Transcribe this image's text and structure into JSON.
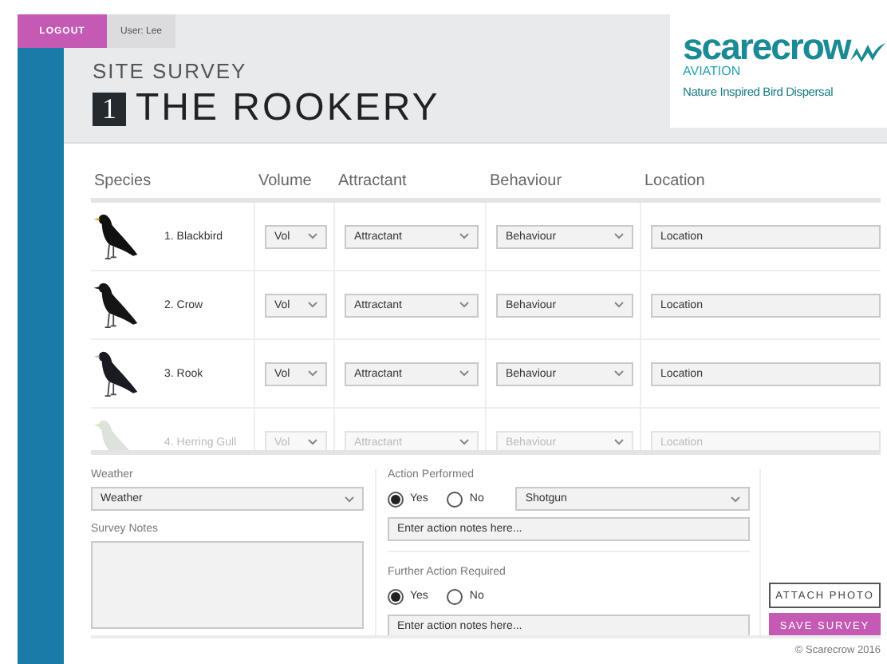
{
  "top_bar": {
    "logout": "LOGOUT",
    "user": "User: Lee"
  },
  "header": {
    "subtitle": "SITE SURVEY",
    "number": "1",
    "title": "THE ROOKERY"
  },
  "logo": {
    "name": "scarecrow",
    "division": "AVIATION",
    "tagline": "Nature Inspired Bird Dispersal"
  },
  "table": {
    "columns": [
      "Species",
      "Volume",
      "Attractant",
      "Behaviour",
      "Location"
    ],
    "rows": [
      {
        "kind": "blackbird",
        "species": "1. Blackbird",
        "volume": "Vol",
        "attractant": "Attractant",
        "behaviour": "Behaviour",
        "location": {
          "placeholder": "Location"
        },
        "dimmed": false
      },
      {
        "kind": "crow",
        "species": "2. Crow",
        "volume": "Vol",
        "attractant": "Attractant",
        "behaviour": "Behaviour",
        "location": {
          "placeholder": "Location"
        },
        "dimmed": false
      },
      {
        "kind": "rook",
        "species": "3. Rook",
        "volume": "Vol",
        "attractant": "Attractant",
        "behaviour": "Behaviour",
        "location": {
          "placeholder": "Location"
        },
        "dimmed": false
      },
      {
        "kind": "gull",
        "species": "4. Herring Gull",
        "volume": "Vol",
        "attractant": "Attractant",
        "behaviour": "Behaviour",
        "location": {
          "placeholder": "Location"
        },
        "dimmed": true
      }
    ]
  },
  "weather": {
    "label": "Weather",
    "value": "Weather"
  },
  "survey_notes": {
    "label": "Survey Notes"
  },
  "action_performed": {
    "label": "Action Performed",
    "options": [
      {
        "label": "Yes",
        "selected": true
      },
      {
        "label": "No",
        "selected": false
      }
    ],
    "method": "Shotgun",
    "notes": {
      "placeholder": "Enter action notes here..."
    }
  },
  "further_action": {
    "label": "Further Action Required",
    "options": [
      {
        "label": "Yes",
        "selected": true
      },
      {
        "label": "No",
        "selected": false
      }
    ],
    "notes": {
      "placeholder": "Enter action notes here..."
    }
  },
  "buttons": [
    {
      "label": "ATTACH PHOTO",
      "kind": "outline"
    },
    {
      "label": "SAVE SURVEY",
      "kind": "primary"
    }
  ],
  "footer": {
    "copyright": "© Scarecrow 2016"
  }
}
